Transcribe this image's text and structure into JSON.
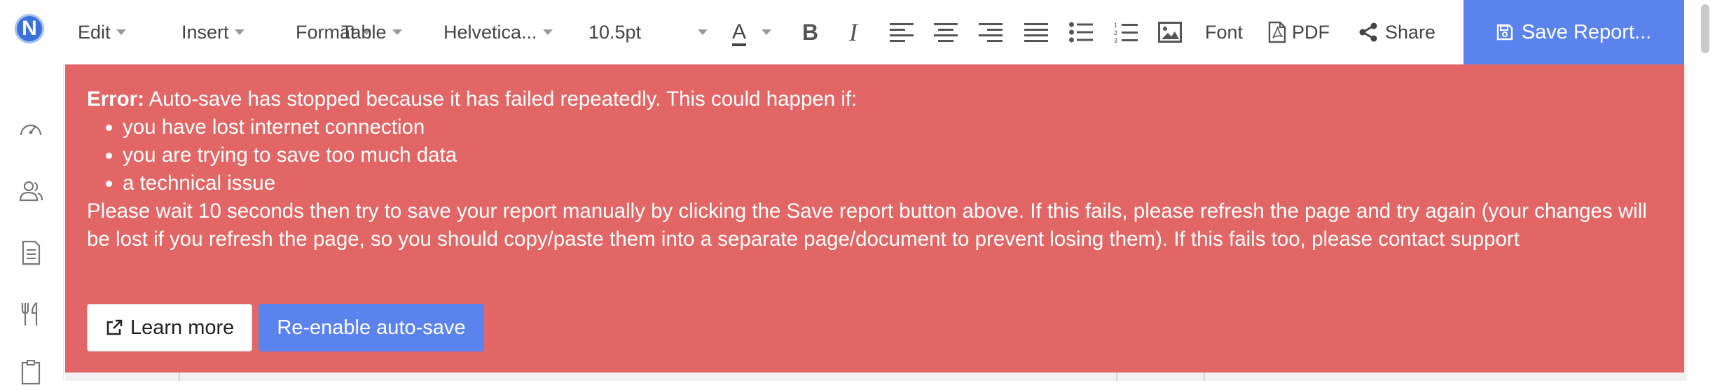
{
  "app": {
    "logo_letter": "N"
  },
  "toolbar": {
    "edit": "Edit",
    "insert": "Insert",
    "format": "Format",
    "table": "Table",
    "font_family": "Helvetica...",
    "font_size": "10.5pt",
    "text_color_letter": "A",
    "bold_letter": "B",
    "italic_letter": "I",
    "font_label": "Font",
    "pdf_label": "PDF",
    "share_label": "Share",
    "save_label": "Save Report..."
  },
  "sidebar": {
    "items": [
      {
        "icon": "dashboard-icon"
      },
      {
        "icon": "users-icon"
      },
      {
        "icon": "document-icon"
      },
      {
        "icon": "utensils-icon"
      },
      {
        "icon": "clipboard-icon"
      }
    ]
  },
  "error": {
    "label": "Error:",
    "intro": " Auto-save has stopped because it has failed repeatedly. This could happen if:",
    "reasons": [
      "you have lost internet connection",
      "you are trying to save too much data",
      "a technical issue"
    ],
    "instructions": "Please wait 10 seconds then try to save your report manually by clicking the Save report button above. If this fails, please refresh the page and try again (your changes will be lost if you refresh the page, so you should copy/paste them into a separate page/document to prevent losing them). If this fails too, please contact support",
    "learn_more": "Learn more",
    "reenable": "Re-enable auto-save"
  },
  "colors": {
    "banner": "#e26665",
    "accent": "#5a83ee"
  }
}
